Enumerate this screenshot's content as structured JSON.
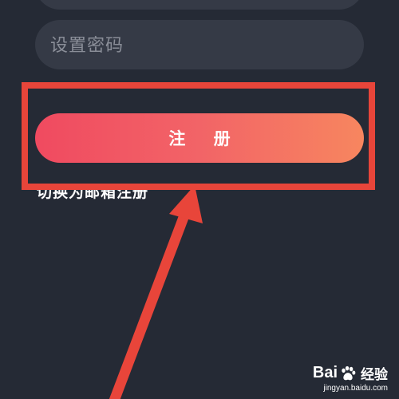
{
  "form": {
    "password_placeholder": "设置密码",
    "register_label": "注 册",
    "switch_link": "切换为邮箱注册"
  },
  "watermark": {
    "brand_left": "Bai",
    "brand_right": "经验",
    "site": "jingyan.baidu.com"
  },
  "colors": {
    "background": "#252a35",
    "input_background": "#353a46",
    "button_gradient_start": "#f04a60",
    "button_gradient_end": "#f7865f",
    "annotation_red": "#e8453a"
  },
  "icons": {
    "watermark_logo": "paw-icon"
  }
}
